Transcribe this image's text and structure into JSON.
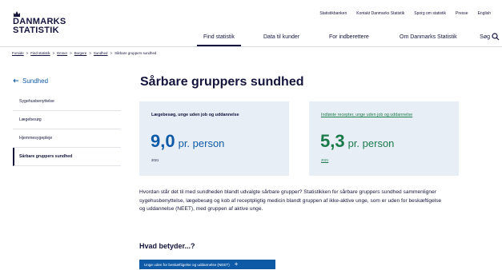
{
  "logo": {
    "line1": "DANMARKS",
    "line2": "STATISTIK"
  },
  "topnav": [
    "Statistikbanken",
    "Kontakt Danmarks Statistik",
    "Sporg om statistik",
    "Presse",
    "English"
  ],
  "mainnav": {
    "items": [
      "Find statistik",
      "Data til kunder",
      "For indberettere",
      "Om Danmarks Statistik"
    ],
    "active": "Find statistik",
    "search_label": "Søg"
  },
  "breadcrumb": {
    "items": [
      "Forside",
      "Find statistik",
      "Emner",
      "Borgere",
      "Sundhed"
    ],
    "current": "Sårbare gruppers sundhed",
    "separator": ">"
  },
  "sidebar": {
    "back_label": "Sundhed",
    "items": [
      "Sygehusbenyttelse",
      "Lægebesøg",
      "Hjemmesygepleje",
      "Sårbare gruppers sundhed"
    ],
    "active_index": 3
  },
  "page_title": "Sårbare gruppers sundhed",
  "cards": [
    {
      "title": "Lægebesøg, unge uden job og uddannelse",
      "number": "9,0",
      "unit": "pr. person",
      "year": "2021",
      "color": "#0f5aa6"
    },
    {
      "title": "Indløste recepter, unge uden job og uddannelse",
      "number": "5,3",
      "unit": "pr. person",
      "year": "2021",
      "color": "#1a7a4a"
    }
  ],
  "intro": "Hvordan står det til med sundheden blandt udvalgte sårbare grupper? Statistikken for sårbare gruppers sundhed sammenligner sygehusbenyttelse, lægebesøg og kob af receptpligtig medicin blandt gruppen af ikke-aktive unge, som er uden for beskæftigelse og uddannelse (NEET), med gruppen af aktive unge.",
  "section_heading": "Hvad betyder...?",
  "accordion": {
    "label": "Unge uden for beskæftigelse og uddannelse (NEET)",
    "icon": "plus-icon"
  },
  "colors": {
    "navy": "#14143c",
    "blue": "#0f5aa6",
    "green": "#1a7a4a",
    "card_bg": "#e8eef6"
  }
}
